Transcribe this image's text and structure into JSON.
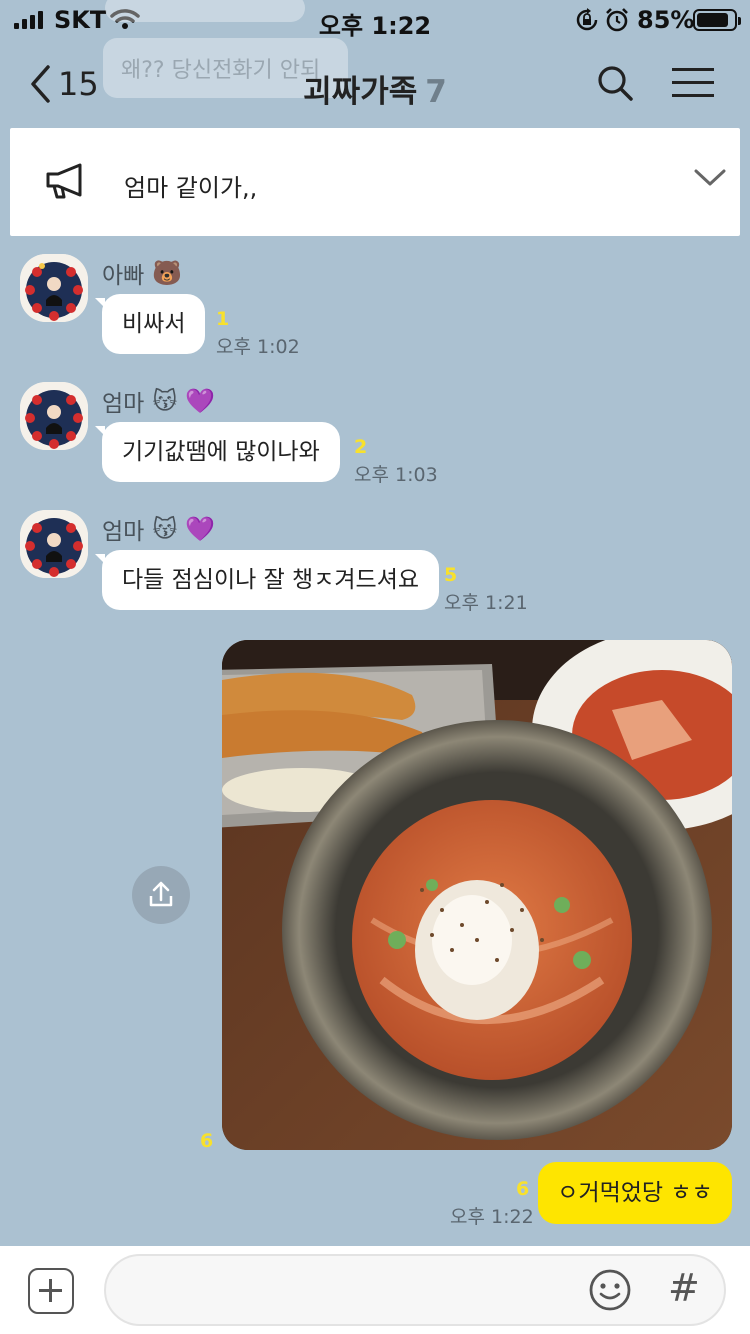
{
  "status_bar": {
    "carrier": "SKT",
    "time": "오후 1:22",
    "battery_percent": "85%",
    "battery_level": 0.85
  },
  "background_notification": {
    "text": "왜?? 당신전화기 안되"
  },
  "header": {
    "back_count": "15",
    "title": "괴짜가족",
    "member_count": "7"
  },
  "notice": {
    "text": "엄마 같이가,,"
  },
  "messages": [
    {
      "sender": "아빠",
      "sender_emojis": "🐻",
      "text": "비싸서",
      "unread": "1",
      "time": "오후 1:02"
    },
    {
      "sender": "엄마",
      "sender_emojis": "😽 💜",
      "text": "기기값땜에  많이나와",
      "unread": "2",
      "time": "오후 1:03"
    },
    {
      "sender": "엄마",
      "sender_emojis": "😽 💜",
      "text": "다들 점심이나 잘 챙ㅈ겨드셔요",
      "unread": "5",
      "time": "오후 1:21"
    }
  ],
  "my_messages": {
    "photo_unread": "6",
    "text": "ㅇ거먹었당 ㅎㅎ",
    "text_unread": "6",
    "time": "오후 1:22"
  },
  "colors": {
    "chat_background": "#abc1d1",
    "my_bubble": "#fee500",
    "unread_count": "#f8e12c"
  }
}
